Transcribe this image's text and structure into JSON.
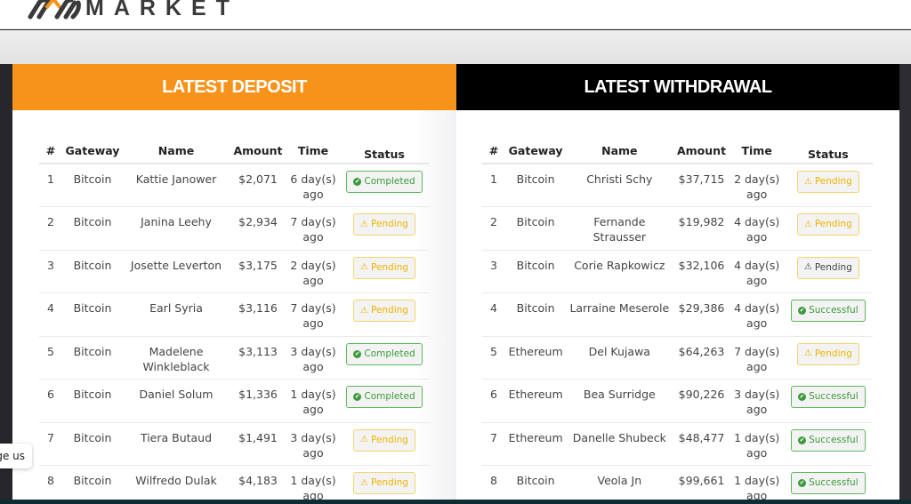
{
  "header": {
    "logo_text": "MARKET",
    "logo_icon": "market-logo-icon"
  },
  "deposit": {
    "title": "LATEST DEPOSIT",
    "accent_color": "#f7931a",
    "columns": [
      "#",
      "Gateway",
      "Name",
      "Amount",
      "Time",
      "Status"
    ],
    "rows": [
      {
        "num": "1",
        "gateway": "Bitcoin",
        "name": "Kattie Janower",
        "amount": "$2,071",
        "time": "6 day(s) ago",
        "status": "Completed",
        "status_type": "completed"
      },
      {
        "num": "2",
        "gateway": "Bitcoin",
        "name": "Janina Leehy",
        "amount": "$2,934",
        "time": "7 day(s) ago",
        "status": "Pending",
        "status_type": "pending"
      },
      {
        "num": "3",
        "gateway": "Bitcoin",
        "name": "Josette Leverton",
        "amount": "$3,175",
        "time": "2 day(s) ago",
        "status": "Pending",
        "status_type": "pending"
      },
      {
        "num": "4",
        "gateway": "Bitcoin",
        "name": "Earl Syria",
        "amount": "$3,116",
        "time": "7 day(s) ago",
        "status": "Pending",
        "status_type": "pending"
      },
      {
        "num": "5",
        "gateway": "Bitcoin",
        "name": "Madelene Winkleblack",
        "amount": "$3,113",
        "time": "3 day(s) ago",
        "status": "Completed",
        "status_type": "completed"
      },
      {
        "num": "6",
        "gateway": "Bitcoin",
        "name": "Daniel Solum",
        "amount": "$1,336",
        "time": "1 day(s) ago",
        "status": "Completed",
        "status_type": "completed"
      },
      {
        "num": "7",
        "gateway": "Bitcoin",
        "name": "Tiera Butaud",
        "amount": "$1,491",
        "time": "3 day(s) ago",
        "status": "Pending",
        "status_type": "pending"
      },
      {
        "num": "8",
        "gateway": "Bitcoin",
        "name": "Wilfredo Dulak",
        "amount": "$4,183",
        "time": "1 day(s) ago",
        "status": "Pending",
        "status_type": "pending"
      }
    ]
  },
  "withdrawal": {
    "title": "LATEST WITHDRAWAL",
    "accent_color": "#000000",
    "columns": [
      "#",
      "Gateway",
      "Name",
      "Amount",
      "Time",
      "Status"
    ],
    "rows": [
      {
        "num": "1",
        "gateway": "Bitcoin",
        "name": "Christi Schy",
        "amount": "$37,715",
        "time": "2 day(s) ago",
        "status": "Pending",
        "status_type": "pending"
      },
      {
        "num": "2",
        "gateway": "Bitcoin",
        "name": "Fernande Strausser",
        "amount": "$19,982",
        "time": "4 day(s) ago",
        "status": "Pending",
        "status_type": "pending"
      },
      {
        "num": "3",
        "gateway": "Bitcoin",
        "name": "Corie Rapkowicz",
        "amount": "$32,106",
        "time": "4 day(s) ago",
        "status": "Pending",
        "status_type": "pending-dark"
      },
      {
        "num": "4",
        "gateway": "Bitcoin",
        "name": "Larraine Meserole",
        "amount": "$29,386",
        "time": "4 day(s) ago",
        "status": "Successful",
        "status_type": "successful"
      },
      {
        "num": "5",
        "gateway": "Ethereum",
        "name": "Del Kujawa",
        "amount": "$64,263",
        "time": "7 day(s) ago",
        "status": "Pending",
        "status_type": "pending"
      },
      {
        "num": "6",
        "gateway": "Ethereum",
        "name": "Bea Surridge",
        "amount": "$90,226",
        "time": "3 day(s) ago",
        "status": "Successful",
        "status_type": "successful"
      },
      {
        "num": "7",
        "gateway": "Ethereum",
        "name": "Danelle Shubeck",
        "amount": "$48,477",
        "time": "1 day(s) ago",
        "status": "Successful",
        "status_type": "successful"
      },
      {
        "num": "8",
        "gateway": "Bitcoin",
        "name": "Veola Jn",
        "amount": "$99,661",
        "time": "1 day(s) ago",
        "status": "Successful",
        "status_type": "successful"
      }
    ]
  },
  "tooltip": {
    "text": "ge us"
  },
  "colors": {
    "completed": "#3c9a3c",
    "pending": "#f0b400",
    "badge_bg": "#f3f3f3"
  }
}
